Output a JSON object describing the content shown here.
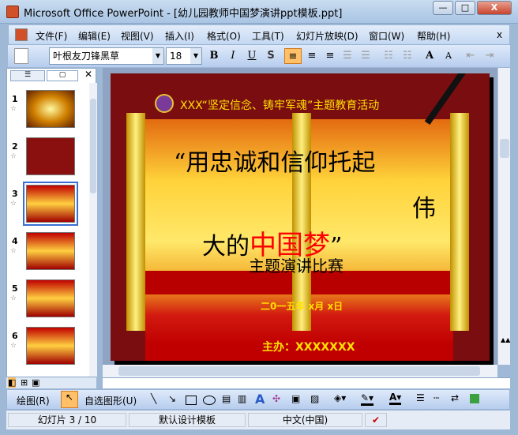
{
  "window": {
    "title": "Microsoft Office PowerPoint - [幼儿园教师中国梦演讲ppt模板.ppt]",
    "min": "—",
    "max": "□",
    "close": "X"
  },
  "menu": [
    "文件(F)",
    "编辑(E)",
    "视图(V)",
    "插入(I)",
    "格式(O)",
    "工具(T)",
    "幻灯片放映(D)",
    "窗口(W)",
    "帮助(H)"
  ],
  "menu_close": "x",
  "format": {
    "font": "叶根友刀锋黑草",
    "size": "18",
    "bold": "B",
    "italic": "I",
    "underline": "U",
    "shadow": "S"
  },
  "left_pane": {
    "slides": [
      "1",
      "2",
      "3",
      "4",
      "5",
      "6"
    ],
    "selected": "3"
  },
  "slide": {
    "header": "XXX“坚定信念、铸牢军魂”主题教育活动",
    "line1": "“用忠诚和信仰托起",
    "line2": "伟",
    "line3a": "大的",
    "line3b": "中国梦",
    "line3c": "”",
    "subtitle": "主题演讲比赛",
    "date": "二0一五年 x月 x日",
    "organizer": "主办：XXXXXXX"
  },
  "draw_toolbar": {
    "draw": "绘图(R)",
    "autoshapes": "自选图形(U)"
  },
  "status": {
    "slide": "幻灯片 3 / 10",
    "template": "默认设计模板",
    "language": "中文(中国)"
  }
}
